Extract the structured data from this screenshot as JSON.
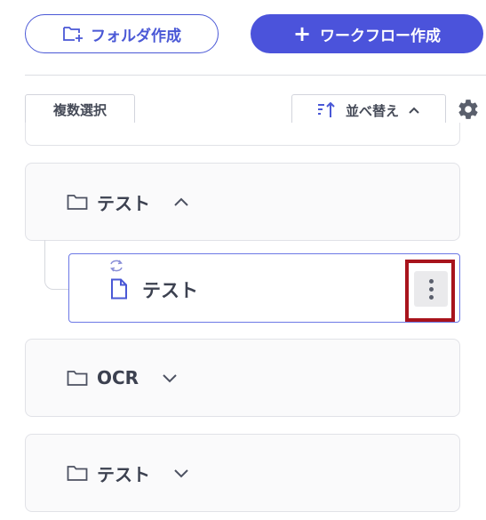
{
  "toolbar": {
    "create_folder_label": "フォルダ作成",
    "create_workflow_label": "ワークフロー作成",
    "multi_select_label": "複数選択",
    "sort_label": "並べ替え"
  },
  "list": {
    "folders": [
      {
        "name": "テスト",
        "expanded": true
      },
      {
        "name": "OCR",
        "expanded": false
      },
      {
        "name": "テスト",
        "expanded": false
      }
    ],
    "workflow_item": {
      "name": "テスト"
    }
  },
  "icons": {
    "create_folder": "folder-plus-icon",
    "create_workflow": "plus-icon",
    "sort": "sort-icon",
    "sort_chevron": "chevron-up-icon",
    "settings": "gear-icon",
    "folder": "folder-icon",
    "expand_up": "chevron-up-icon",
    "expand_down": "chevron-down-icon",
    "sync": "sync-icon",
    "document": "document-icon",
    "more": "more-vertical-icon"
  },
  "colors": {
    "primary": "#4b53db",
    "primary_outline": "#4a58d6",
    "highlight_box": "#a8131c",
    "icon_gray": "#5a5f6c"
  }
}
